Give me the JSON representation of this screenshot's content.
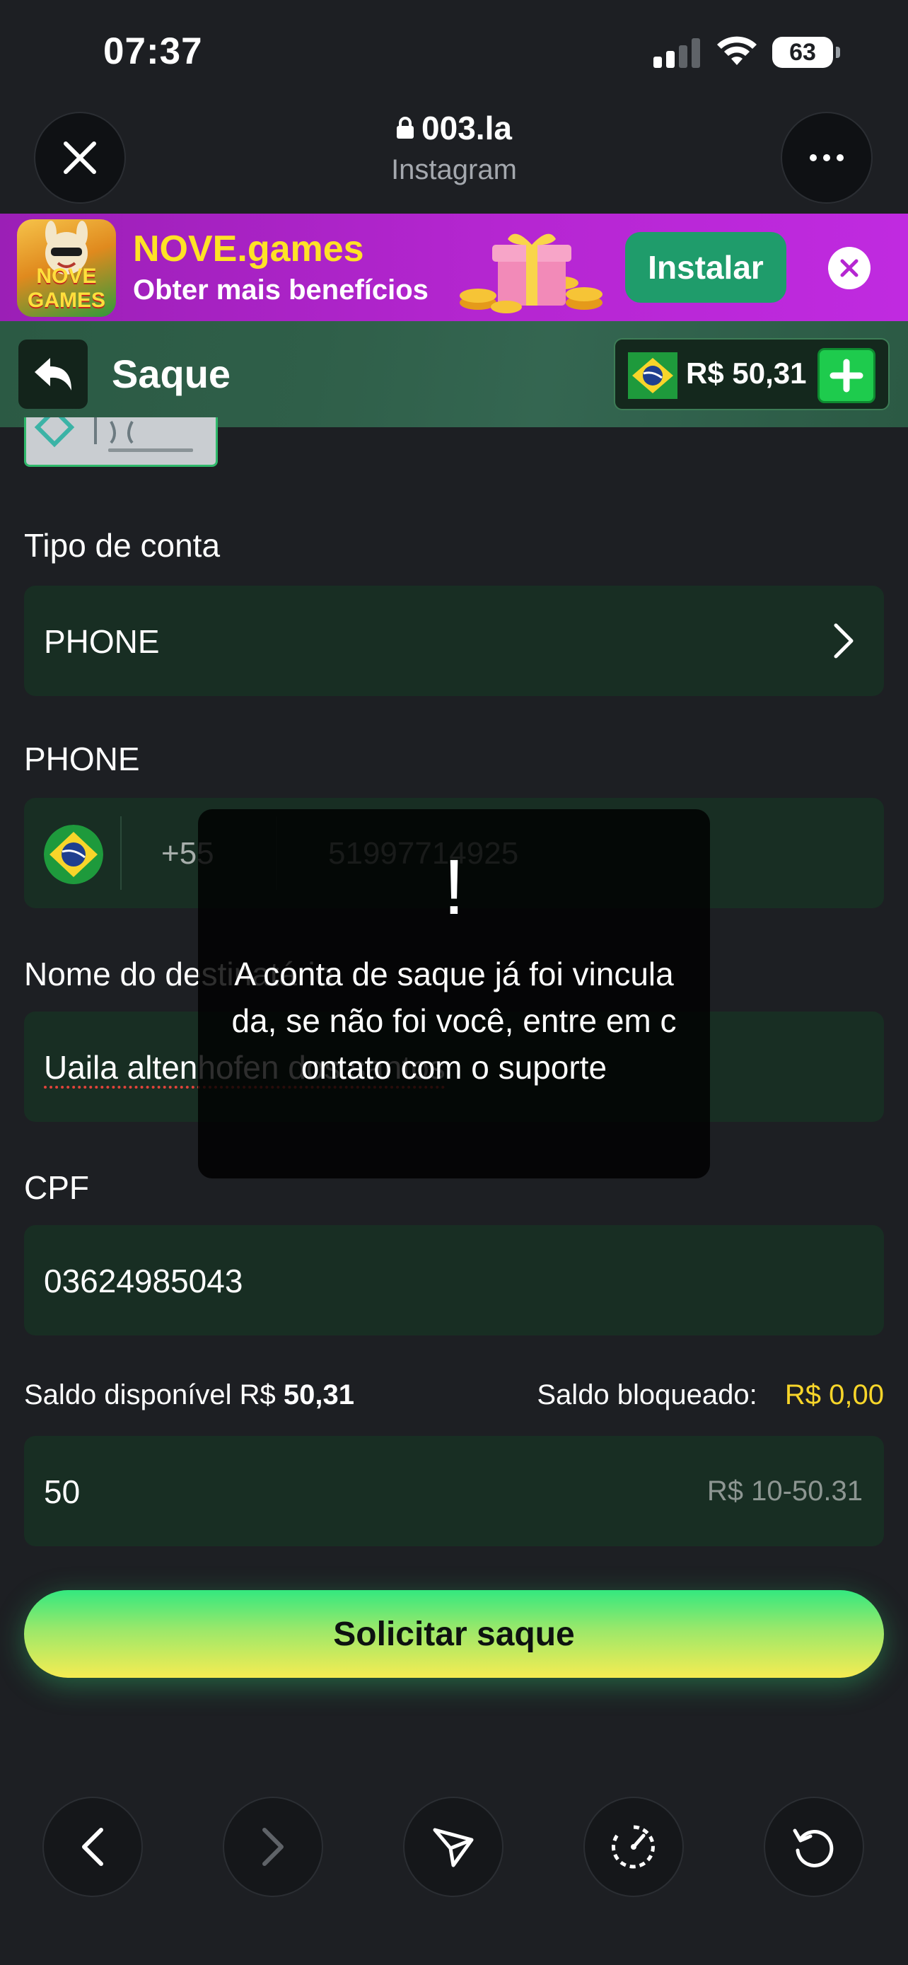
{
  "status_bar": {
    "time": "07:37",
    "battery": "63"
  },
  "browser": {
    "domain": "003.la",
    "source": "Instagram"
  },
  "promo": {
    "title": "NOVE.games",
    "subtitle": "Obter mais benefícios",
    "install_label": "Instalar",
    "logo_text": "NOVE GAMES"
  },
  "header": {
    "title": "Saque",
    "balance": "R$ 50,31"
  },
  "form": {
    "account_type_label": "Tipo de conta",
    "account_type_value": "PHONE",
    "phone_label": "PHONE",
    "phone_dial_code": "+55",
    "phone_number": "51997714925",
    "recipient_label": "Nome do destinatário",
    "recipient_value": "Uaila altenhofen dos santos",
    "cpf_label": "CPF",
    "cpf_value": "03624985043",
    "saldo_disponivel_label": "Saldo disponível R$",
    "saldo_disponivel_value": "50,31",
    "saldo_bloqueado_label": "Saldo bloqueado:",
    "saldo_bloqueado_value": "R$ 0,00",
    "amount_value": "50",
    "amount_range": "R$ 10-50.31",
    "submit_label": "Solicitar saque"
  },
  "toast": {
    "icon": "!",
    "message": "A conta de saque já foi vinculada, se não foi você, entre em contato com o suporte"
  },
  "colors": {
    "background": "#1d1f23",
    "field": "#182e23",
    "accent_green": "#1ecb4d",
    "promo_purple": "#b526d1",
    "blocked_yellow": "#f7d52a"
  }
}
